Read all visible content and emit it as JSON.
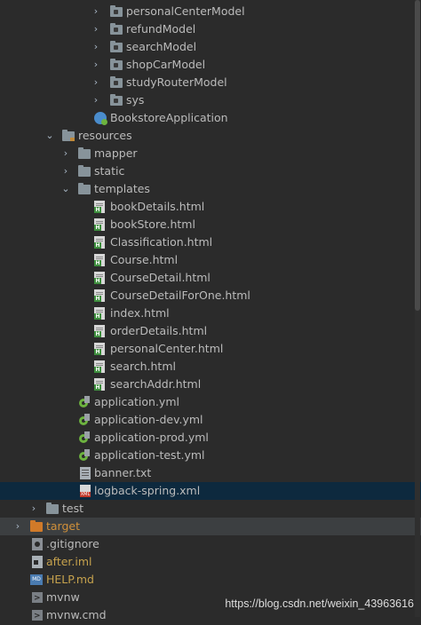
{
  "tree": {
    "items": [
      {
        "label": "personalCenterModel"
      },
      {
        "label": "refundModel"
      },
      {
        "label": "searchModel"
      },
      {
        "label": "shopCarModel"
      },
      {
        "label": "studyRouterModel"
      },
      {
        "label": "sys"
      },
      {
        "label": "BookstoreApplication"
      },
      {
        "label": "resources"
      },
      {
        "label": "mapper"
      },
      {
        "label": "static"
      },
      {
        "label": "templates"
      },
      {
        "label": "bookDetails.html"
      },
      {
        "label": "bookStore.html"
      },
      {
        "label": "Classification.html"
      },
      {
        "label": "Course.html"
      },
      {
        "label": "CourseDetail.html"
      },
      {
        "label": "CourseDetailForOne.html"
      },
      {
        "label": "index.html"
      },
      {
        "label": "orderDetails.html"
      },
      {
        "label": "personalCenter.html"
      },
      {
        "label": "search.html"
      },
      {
        "label": "searchAddr.html"
      },
      {
        "label": "application.yml"
      },
      {
        "label": "application-dev.yml"
      },
      {
        "label": "application-prod.yml"
      },
      {
        "label": "application-test.yml"
      },
      {
        "label": "banner.txt"
      },
      {
        "label": "logback-spring.xml"
      },
      {
        "label": "test"
      },
      {
        "label": "target"
      },
      {
        "label": ".gitignore"
      },
      {
        "label": "after.iml"
      },
      {
        "label": "HELP.md"
      },
      {
        "label": "mvnw"
      },
      {
        "label": "mvnw.cmd"
      }
    ]
  },
  "watermark": "https://blog.csdn.net/weixin_43963616"
}
